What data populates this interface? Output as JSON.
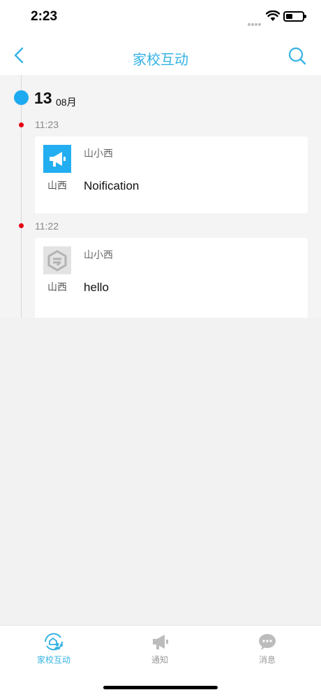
{
  "status": {
    "time": "2:23"
  },
  "nav": {
    "title": "家校互动"
  },
  "timeline": {
    "day": "13",
    "month": "08月",
    "entries": [
      {
        "time": "11:23",
        "sender": "山小西",
        "school": "山西",
        "message": "Noification",
        "avatar": "megaphone-icon"
      },
      {
        "time": "11:22",
        "sender": "山小西",
        "school": "山西",
        "message": "hello",
        "avatar": "app-logo-icon"
      }
    ]
  },
  "tabs": [
    {
      "label": "家校互动",
      "icon": "home-school-icon",
      "active": true
    },
    {
      "label": "通知",
      "icon": "megaphone-icon",
      "active": false
    },
    {
      "label": "消息",
      "icon": "chat-bubble-icon",
      "active": false
    }
  ],
  "colors": {
    "accent": "#35b3e4",
    "timeline_dot": "#e60012",
    "date_dot": "#1eaaf1"
  }
}
